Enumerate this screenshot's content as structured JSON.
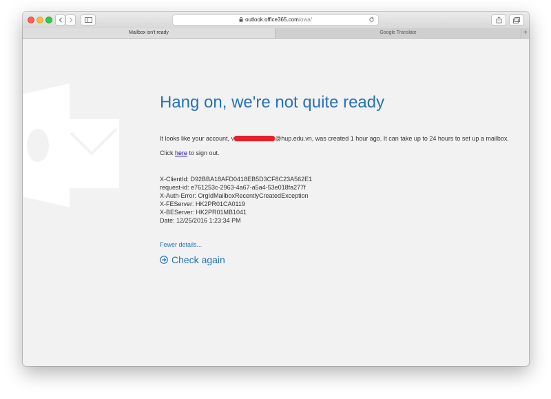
{
  "browser": {
    "address_host": "outlook.office365.com",
    "address_path": "/owa/",
    "tabs": [
      {
        "label": "Mailbox isn't ready"
      },
      {
        "label": "Google Translate"
      }
    ],
    "new_tab_label": "+"
  },
  "page": {
    "title": "Hang on, we're not quite ready",
    "message_prefix": "It looks like your account, ",
    "message_redacted_start": "v",
    "message_suffix": "@hup.edu.vn, was created 1 hour ago. It can take up to 24 hours to set up a mailbox.",
    "signout_prefix": "Click ",
    "signout_link": "here",
    "signout_suffix": " to sign out.",
    "details": [
      "X-ClientId: D92BBA18AFD0418EB5D3CF8C23A562E1",
      "request-id: e761253c-2963-4a67-a5a4-53e018fa277f",
      "X-Auth-Error: OrgIdMailboxRecentlyCreatedException",
      "X-FEServer: HK2PR01CA0119",
      "X-BEServer: HK2PR01MB1041",
      "Date: 12/25/2016 1:23:34 PM"
    ],
    "fewer_details": "Fewer details...",
    "check_again": "Check again"
  },
  "colors": {
    "accent": "#2672ba",
    "redaction": "#e8202a"
  }
}
